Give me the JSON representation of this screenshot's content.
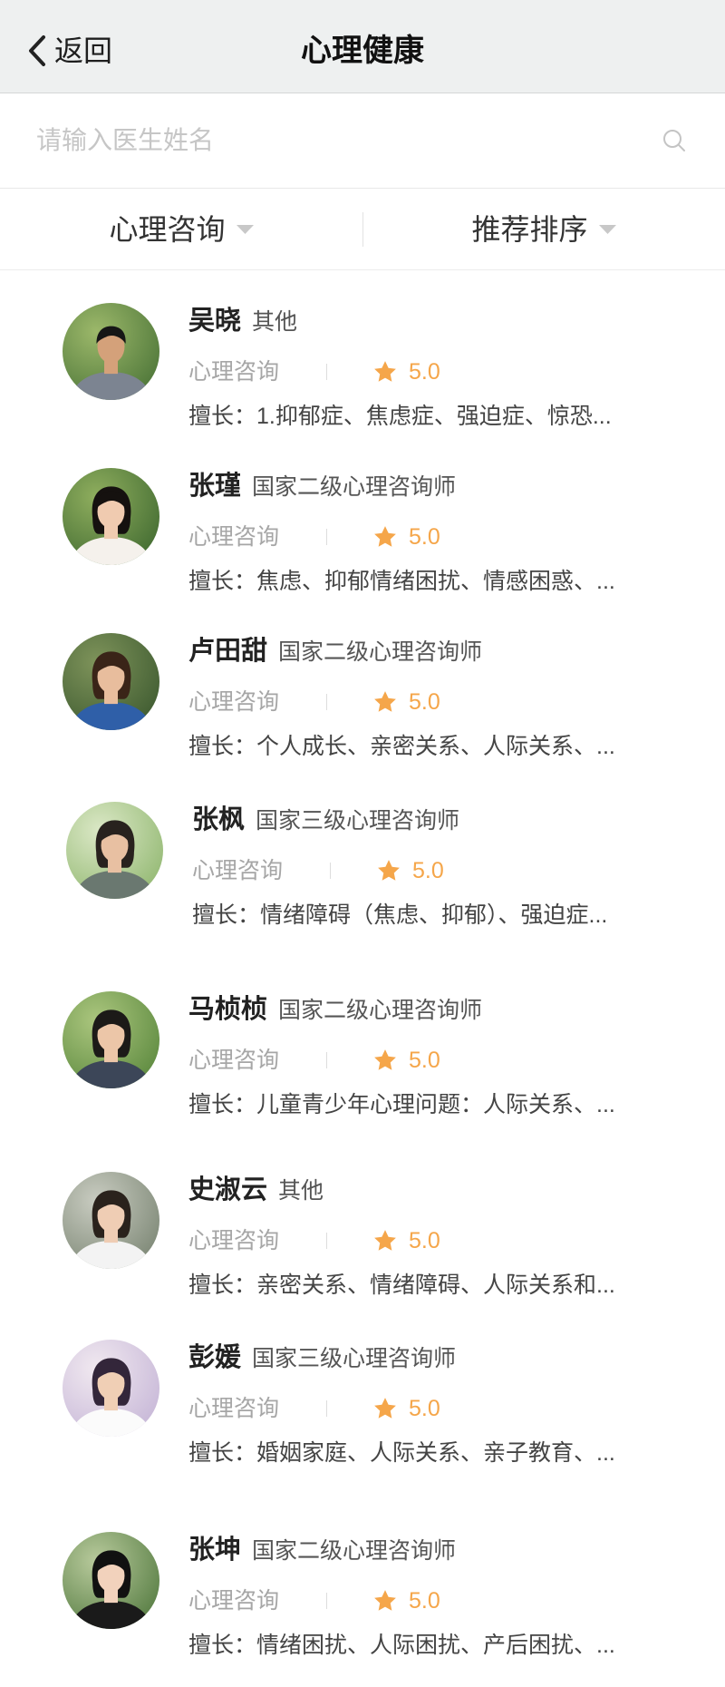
{
  "header": {
    "back_label": "返回",
    "title": "心理健康"
  },
  "search": {
    "placeholder": "请输入医生姓名"
  },
  "filters": [
    {
      "label": "心理咨询"
    },
    {
      "label": "推荐排序"
    }
  ],
  "doctors": [
    {
      "name": "吴晓",
      "title": "其他",
      "category": "心理咨询",
      "rating": "5.0",
      "specialty_label": "擅长：",
      "specialty": "1.抑郁症、焦虑症、强迫症、惊恐..."
    },
    {
      "name": "张瑾",
      "title": "国家二级心理咨询师",
      "category": "心理咨询",
      "rating": "5.0",
      "specialty_label": "擅长：",
      "specialty": "焦虑、抑郁情绪困扰、情感困惑、..."
    },
    {
      "name": "卢田甜",
      "title": "国家二级心理咨询师",
      "category": "心理咨询",
      "rating": "5.0",
      "specialty_label": "擅长：",
      "specialty": "个人成长、亲密关系、人际关系、..."
    },
    {
      "name": "张枫",
      "title": "国家三级心理咨询师",
      "category": "心理咨询",
      "rating": "5.0",
      "specialty_label": "擅长：",
      "specialty": "情绪障碍（焦虑、抑郁）、强迫症..."
    },
    {
      "name": "马桢桢",
      "title": "国家二级心理咨询师",
      "category": "心理咨询",
      "rating": "5.0",
      "specialty_label": "擅长：",
      "specialty": "儿童青少年心理问题：人际关系、..."
    },
    {
      "name": "史淑云",
      "title": "其他",
      "category": "心理咨询",
      "rating": "5.0",
      "specialty_label": "擅长：",
      "specialty": "亲密关系、情绪障碍、人际关系和..."
    },
    {
      "name": "彭媛",
      "title": "国家三级心理咨询师",
      "category": "心理咨询",
      "rating": "5.0",
      "specialty_label": "擅长：",
      "specialty": "婚姻家庭、人际关系、亲子教育、..."
    },
    {
      "name": "张坤",
      "title": "国家二级心理咨询师",
      "category": "心理咨询",
      "rating": "5.0",
      "specialty_label": "擅长：",
      "specialty": "情绪困扰、人际困扰、产后困扰、..."
    }
  ],
  "colors": {
    "accent": "#f5a64a",
    "header_bg": "#eef0f0"
  },
  "icons": {
    "back": "chevron-left-icon",
    "search": "search-icon",
    "filter_caret": "caret-down-icon",
    "rating": "star-icon"
  }
}
